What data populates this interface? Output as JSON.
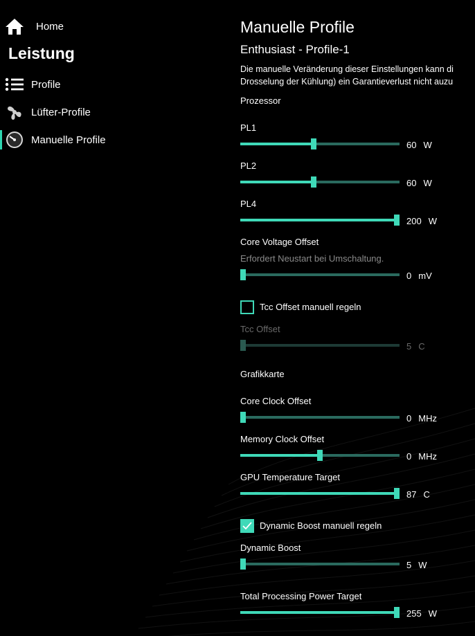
{
  "sidebar": {
    "home_label": "Home",
    "section_title": "Leistung",
    "items": [
      {
        "label": "Profile",
        "icon": "list-icon"
      },
      {
        "label": "Lüfter-Profile",
        "icon": "fan-icon"
      },
      {
        "label": "Manuelle Profile",
        "icon": "speedometer-icon"
      }
    ]
  },
  "main": {
    "title": "Manuelle Profile",
    "subtitle": "Enthusiast - Profile-1",
    "warning_line1": "Die manuelle Veränderung dieser Einstellungen kann di",
    "warning_line2": "Drosselung der Kühlung) ein Garantieverlust nicht auzu",
    "processor_heading": "Prozessor",
    "gpu_heading": "Grafikkarte"
  },
  "settings": {
    "pl1": {
      "label": "PL1",
      "value": "60",
      "unit": "W",
      "level": 0.46
    },
    "pl2": {
      "label": "PL2",
      "value": "60",
      "unit": "W",
      "level": 0.46
    },
    "pl4": {
      "label": "PL4",
      "value": "200",
      "unit": "W",
      "level": 1.0
    },
    "core_voltage": {
      "label": "Core Voltage Offset",
      "note": "Erfordert Neustart bei Umschaltung.",
      "value": "0",
      "unit": "mV",
      "level": 0.0
    },
    "tcc_toggle": {
      "label": "Tcc Offset manuell regeln",
      "checked": false
    },
    "tcc": {
      "label": "Tcc Offset",
      "value": "5",
      "unit": "C",
      "level": 0.0,
      "disabled": true
    },
    "core_clock": {
      "label": "Core Clock Offset",
      "value": "0",
      "unit": "MHz",
      "level": 0.0
    },
    "memory_clock": {
      "label": "Memory Clock Offset",
      "value": "0",
      "unit": "MHz",
      "level": 0.5
    },
    "gpu_temp": {
      "label": "GPU Temperature Target",
      "value": "87",
      "unit": "C",
      "level": 1.0
    },
    "dynamic_boost_toggle": {
      "label": "Dynamic Boost manuell regeln",
      "checked": true
    },
    "dynamic_boost": {
      "label": "Dynamic Boost",
      "value": "5",
      "unit": "W",
      "level": 0.0
    },
    "total_power": {
      "label": "Total Processing Power Target",
      "value": "255",
      "unit": "W",
      "level": 1.0
    }
  },
  "colors": {
    "accent": "#3fd9b8",
    "track": "#2a6a5e",
    "background": "#000000"
  }
}
